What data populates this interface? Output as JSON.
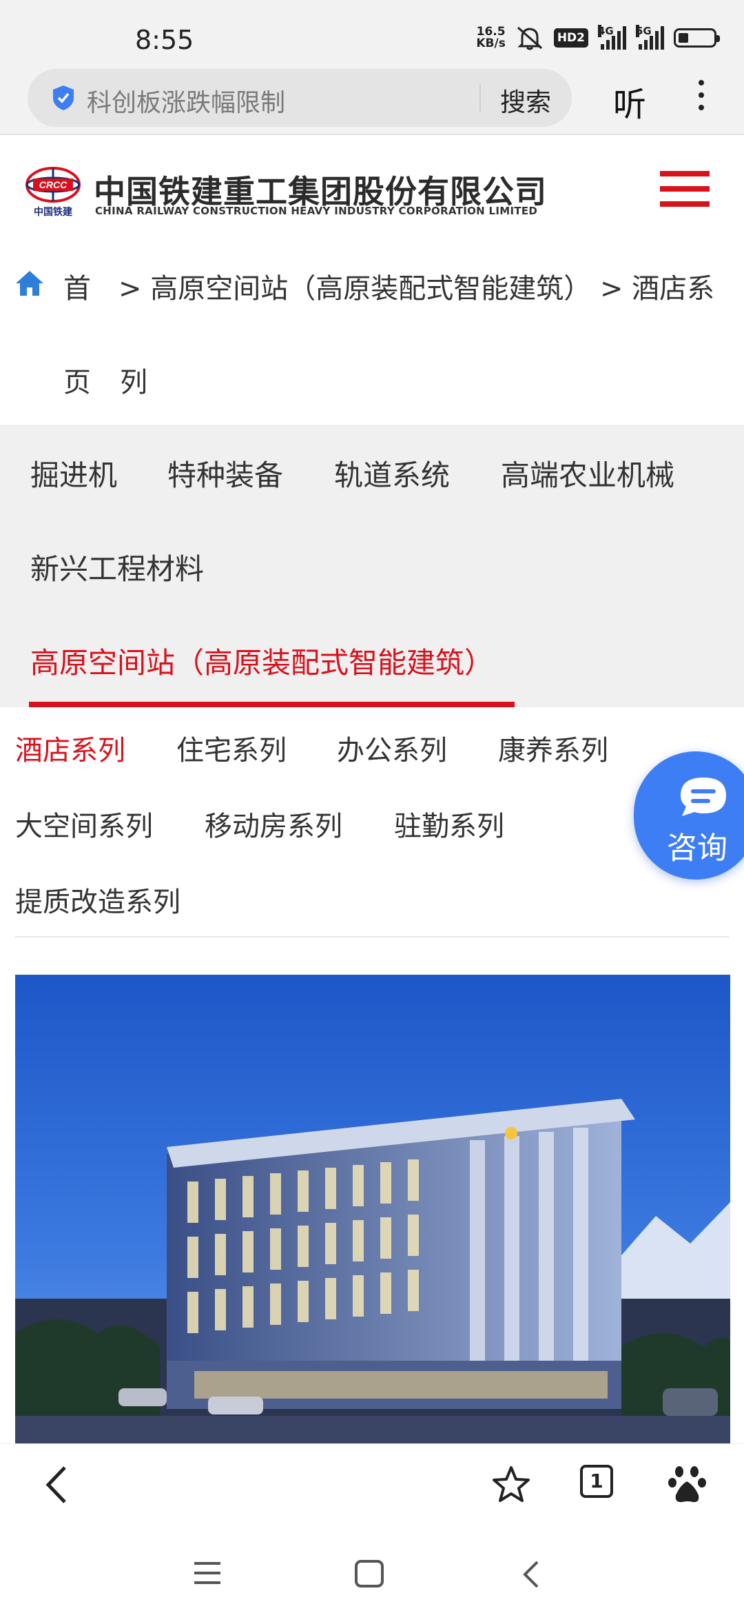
{
  "status_bar": {
    "time": "8:55",
    "net_speed_value": "16.5",
    "net_speed_unit": "KB/s",
    "hd_badge": "HD2",
    "signal_1_label": "4G",
    "signal_2_label": "5G",
    "icons": [
      "mute-icon",
      "signal-icon",
      "battery-icon"
    ]
  },
  "search_bar": {
    "query": "科创板涨跌幅限制",
    "search_button": "搜索",
    "listen_button": "听"
  },
  "site_header": {
    "company_name_cn": "中国铁建重工集团股份有限公司",
    "company_name_en": "CHINA RAILWAY CONSTRUCTION HEAVY INDUSTRY CORPORATION LIMITED",
    "logo_text": "CRCC",
    "logo_sub": "中国铁建",
    "brand_color": "#d8111b"
  },
  "breadcrumb": {
    "home_part1": "首",
    "home_part2": "页",
    "path_line1": "> 高原空间站（高原装配式智能建筑） > 酒店系",
    "path_line2": "列"
  },
  "category_nav": {
    "items": [
      {
        "label": "掘进机"
      },
      {
        "label": "特种装备"
      },
      {
        "label": "轨道系统"
      },
      {
        "label": "高端农业机械"
      },
      {
        "label": "新兴工程材料"
      },
      {
        "label": "高原空间站（高原装配式智能建筑）",
        "active": true
      }
    ]
  },
  "sub_nav": {
    "items": [
      {
        "label": "酒店系列",
        "active": true
      },
      {
        "label": "住宅系列"
      },
      {
        "label": "办公系列"
      },
      {
        "label": "康养系列"
      },
      {
        "label": "大空间系列"
      },
      {
        "label": "移动房系列"
      },
      {
        "label": "驻勤系列"
      },
      {
        "label": "提质改造系列"
      }
    ]
  },
  "consult_button": {
    "label": "咨询",
    "color": "#3d7ef5"
  },
  "product": {
    "image_subject": "hotel building at night"
  },
  "bottom_toolbar": {
    "tab_count": "1",
    "icons": [
      "back-arrow-icon",
      "star-icon",
      "tabs-icon",
      "baidu-paw-icon"
    ]
  }
}
